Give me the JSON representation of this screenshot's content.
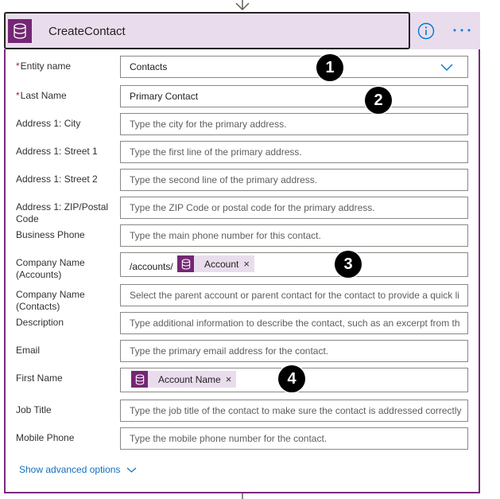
{
  "action": {
    "title": "CreateContact",
    "icons": {
      "header": "database-icon",
      "info": "info-icon",
      "more": "more-icon"
    },
    "accent_color": "#742774"
  },
  "fields": {
    "entity_name": {
      "label": "Entity name",
      "required": "*",
      "value": "Contacts"
    },
    "last_name": {
      "label": "Last Name",
      "required": "*",
      "value": "Primary Contact"
    },
    "address_city": {
      "label": "Address 1: City",
      "placeholder": "Type the city for the primary address."
    },
    "address_street1": {
      "label": "Address 1: Street 1",
      "placeholder": "Type the first line of the primary address."
    },
    "address_street2": {
      "label": "Address 1: Street 2",
      "placeholder": "Type the second line of the primary address."
    },
    "address_zip": {
      "label": "Address 1: ZIP/Postal Code",
      "placeholder": "Type the ZIP Code or postal code for the primary address."
    },
    "business_phone": {
      "label": "Business Phone",
      "placeholder": "Type the main phone number for this contact."
    },
    "company_accounts": {
      "label": "Company Name (Accounts)",
      "prefix": "/accounts/",
      "token": "Account"
    },
    "company_contacts": {
      "label": "Company Name (Contacts)",
      "placeholder": "Select the parent account or parent contact for the contact to provide a quick li"
    },
    "description": {
      "label": "Description",
      "placeholder": "Type additional information to describe the contact, such as an excerpt from th"
    },
    "email": {
      "label": "Email",
      "placeholder": "Type the primary email address for the contact."
    },
    "first_name": {
      "label": "First Name",
      "token": "Account Name"
    },
    "job_title": {
      "label": "Job Title",
      "placeholder": "Type the job title of the contact to make sure the contact is addressed correctly"
    },
    "mobile_phone": {
      "label": "Mobile Phone",
      "placeholder": "Type the mobile phone number for the contact."
    }
  },
  "token_remove_glyph": "×",
  "badges": [
    "1",
    "2",
    "3",
    "4"
  ],
  "advanced_options": "Show advanced options"
}
